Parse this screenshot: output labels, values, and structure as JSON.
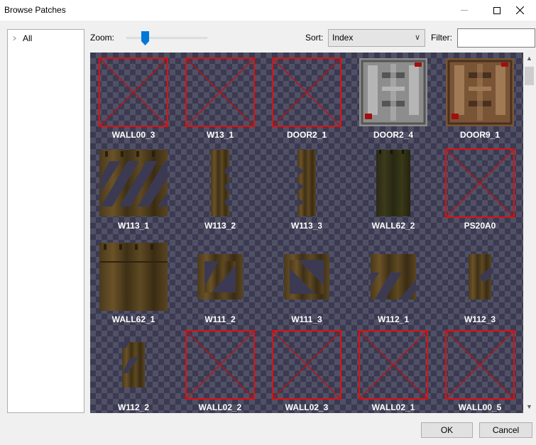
{
  "window": {
    "title": "Browse Patches"
  },
  "tree": {
    "items": [
      {
        "label": "All"
      }
    ]
  },
  "toolbar": {
    "zoom_label": "Zoom:",
    "zoom_level": 0.2,
    "sort_label": "Sort:",
    "sort_value": "Index",
    "filter_label": "Filter:",
    "filter_value": ""
  },
  "patches": [
    {
      "name": "WALL00_3",
      "kind": "missing"
    },
    {
      "name": "W13_1",
      "kind": "missing"
    },
    {
      "name": "DOOR2_1",
      "kind": "missing"
    },
    {
      "name": "DOOR2_4",
      "kind": "door-gray"
    },
    {
      "name": "DOOR9_1",
      "kind": "door-brown"
    },
    {
      "name": "W113_1",
      "kind": "wood-diagonal"
    },
    {
      "name": "W113_2",
      "kind": "wood-notch-post"
    },
    {
      "name": "W113_3",
      "kind": "wood-notch-post-left"
    },
    {
      "name": "WALL62_2",
      "kind": "wood-dark-narrow"
    },
    {
      "name": "PS20A0",
      "kind": "missing"
    },
    {
      "name": "WALL62_1",
      "kind": "wood-wide"
    },
    {
      "name": "W111_2",
      "kind": "wood-frame-diag"
    },
    {
      "name": "W111_3",
      "kind": "wood-frame-diag2"
    },
    {
      "name": "W112_1",
      "kind": "wood-half-diag"
    },
    {
      "name": "W112_3",
      "kind": "wood-narrow-notch"
    },
    {
      "name": "W112_2",
      "kind": "wood-small-diag"
    },
    {
      "name": "WALL02_2",
      "kind": "missing"
    },
    {
      "name": "WALL02_3",
      "kind": "missing"
    },
    {
      "name": "WALL02_1",
      "kind": "missing"
    },
    {
      "name": "WALL00_5",
      "kind": "missing"
    }
  ],
  "buttons": {
    "ok": "OK",
    "cancel": "Cancel"
  }
}
